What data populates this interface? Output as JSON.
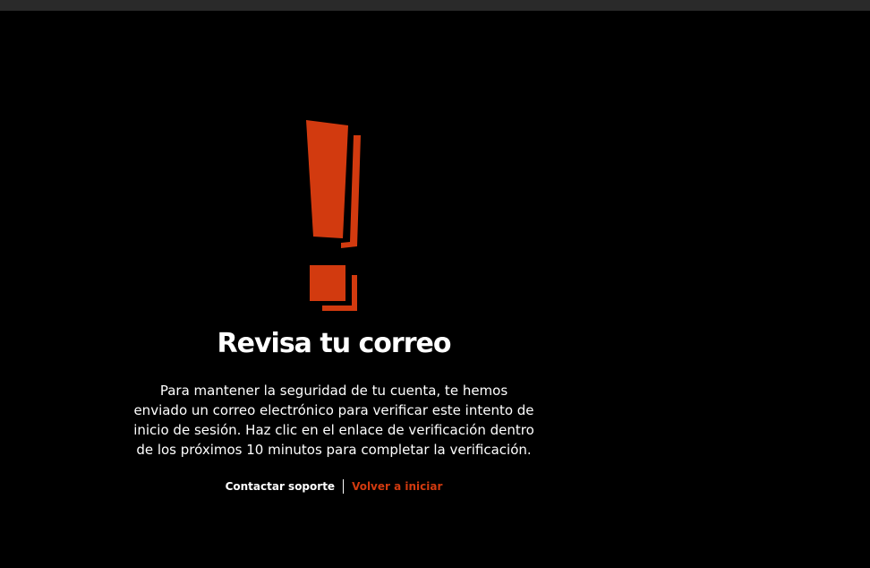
{
  "colors": {
    "background": "#000000",
    "accent": "#d23a0f",
    "text": "#ffffff"
  },
  "icon": "exclamation-mark-icon",
  "main": {
    "title": "Revisa tu correo",
    "message": "Para mantener la seguridad de tu cuenta, te hemos enviado un correo electrónico para verificar este intento de inicio de sesión. Haz clic en el enlace de verificación dentro de los próximos 10 minutos para completar la verificación."
  },
  "links": {
    "support_label": "Contactar soporte",
    "back_label": "Volver a iniciar"
  }
}
